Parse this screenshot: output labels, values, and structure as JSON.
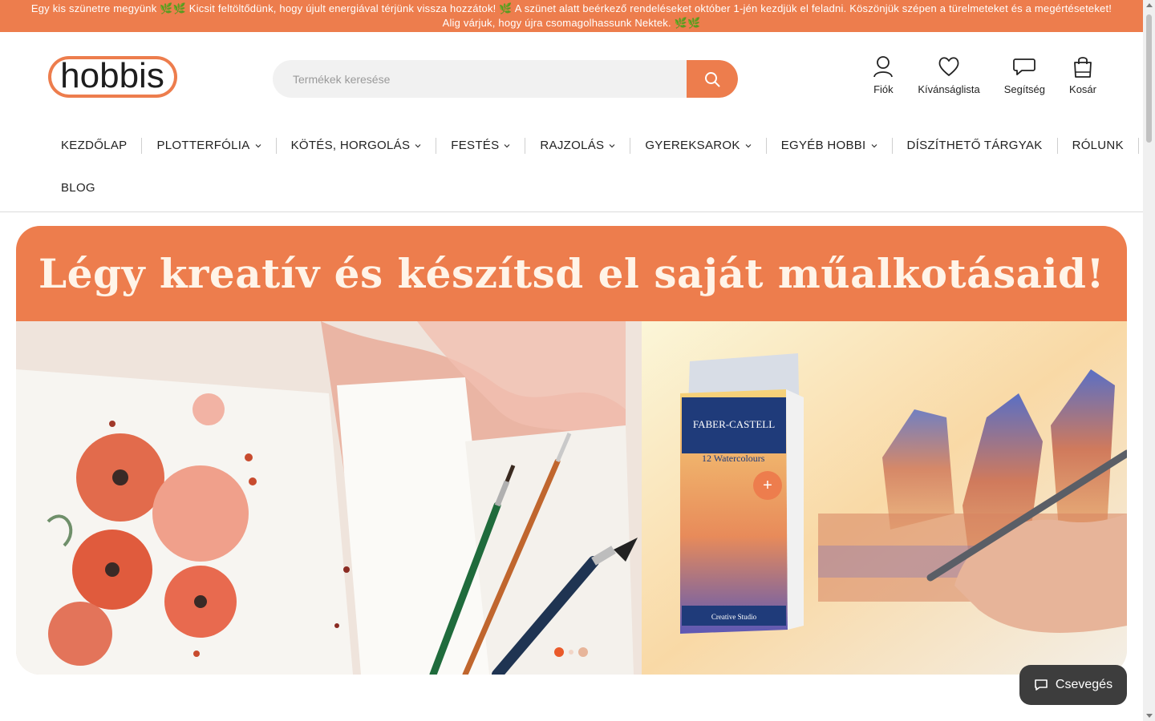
{
  "announcement": {
    "line1": "Egy kis szünetre megyünk 🌿🌿 Kicsit feltöltődünk, hogy újult energiával térjünk vissza hozzátok! 🌿 A szünet alatt beérkező rendeléseket október 1-jén kezdjük el feladni. Köszönjük szépen a türelmeteket és a megértéseteket!",
    "line2": "Alig várjuk, hogy újra csomagolhassunk Nektek. 🌿🌿"
  },
  "logo": {
    "text": "hobbis"
  },
  "search": {
    "placeholder": "Termékek keresése"
  },
  "header_icons": [
    {
      "label": "Fiók",
      "icon": "user-icon"
    },
    {
      "label": "Kívánságlista",
      "icon": "heart-icon"
    },
    {
      "label": "Segítség",
      "icon": "chat-bubble-icon"
    },
    {
      "label": "Kosár",
      "icon": "shopping-bag-icon"
    }
  ],
  "nav": {
    "items": [
      {
        "label": "KEZDŐLAP",
        "dropdown": false
      },
      {
        "label": "PLOTTERFÓLIA",
        "dropdown": true
      },
      {
        "label": "KÖTÉS, HORGOLÁS",
        "dropdown": true
      },
      {
        "label": "FESTÉS",
        "dropdown": true
      },
      {
        "label": "RAJZOLÁS",
        "dropdown": true
      },
      {
        "label": "GYEREKSAROK",
        "dropdown": true
      },
      {
        "label": "EGYÉB HOBBI",
        "dropdown": true
      },
      {
        "label": "DÍSZÍTHETŐ TÁRGYAK",
        "dropdown": false
      },
      {
        "label": "RÓLUNK",
        "dropdown": false
      },
      {
        "label": "BLOG",
        "dropdown": false
      }
    ]
  },
  "hero": {
    "headline": "Légy kreatív és készítsd el saját műalkotásaid!",
    "product_brand": "FABER-CASTELL",
    "product_name": "12 Watercolours",
    "product_line": "Creative Studio",
    "slides": 3,
    "active_slide": 1
  },
  "chat": {
    "label": "Csevegés"
  },
  "colors": {
    "accent": "#ed7d4d",
    "chat_bg": "#3d3d3d"
  }
}
